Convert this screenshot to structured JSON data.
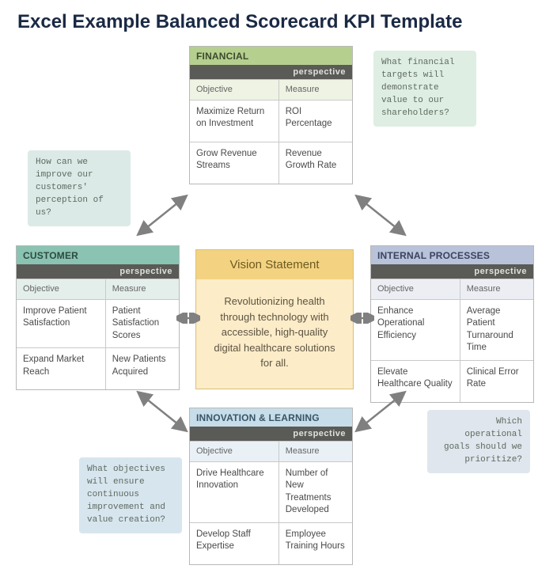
{
  "title": "Excel Example Balanced Scorecard KPI Template",
  "perspective_label": "perspective",
  "col_objective": "Objective",
  "col_measure": "Measure",
  "vision": {
    "heading": "Vision Statement",
    "body": "Revolutionizing health through technology with accessible, high-quality digital healthcare solutions for all."
  },
  "cards": {
    "financial": {
      "title": "FINANCIAL",
      "callout": "What financial targets will demonstrate value to our shareholders?",
      "rows": [
        {
          "objective": "Maximize Return on Investment",
          "measure": "ROI Percentage"
        },
        {
          "objective": "Grow Revenue Streams",
          "measure": "Revenue Growth Rate"
        }
      ]
    },
    "customer": {
      "title": "CUSTOMER",
      "callout": "How can we improve our customers' perception of us?",
      "rows": [
        {
          "objective": "Improve Patient Satisfaction",
          "measure": "Patient Satisfaction Scores"
        },
        {
          "objective": "Expand Market Reach",
          "measure": "New Patients Acquired"
        }
      ]
    },
    "internal": {
      "title": "INTERNAL PROCESSES",
      "callout": "Which operational goals should we prioritize?",
      "rows": [
        {
          "objective": "Enhance Operational Efficiency",
          "measure": "Average Patient Turnaround Time"
        },
        {
          "objective": "Elevate Healthcare Quality",
          "measure": "Clinical Error Rate"
        }
      ]
    },
    "innovation": {
      "title": "INNOVATION & LEARNING",
      "callout": "What objectives will ensure continuous improvement and value creation?",
      "rows": [
        {
          "objective": "Drive Healthcare Innovation",
          "measure": "Number of New Treatments Developed"
        },
        {
          "objective": "Develop Staff Expertise",
          "measure": "Employee Training Hours"
        }
      ]
    }
  }
}
